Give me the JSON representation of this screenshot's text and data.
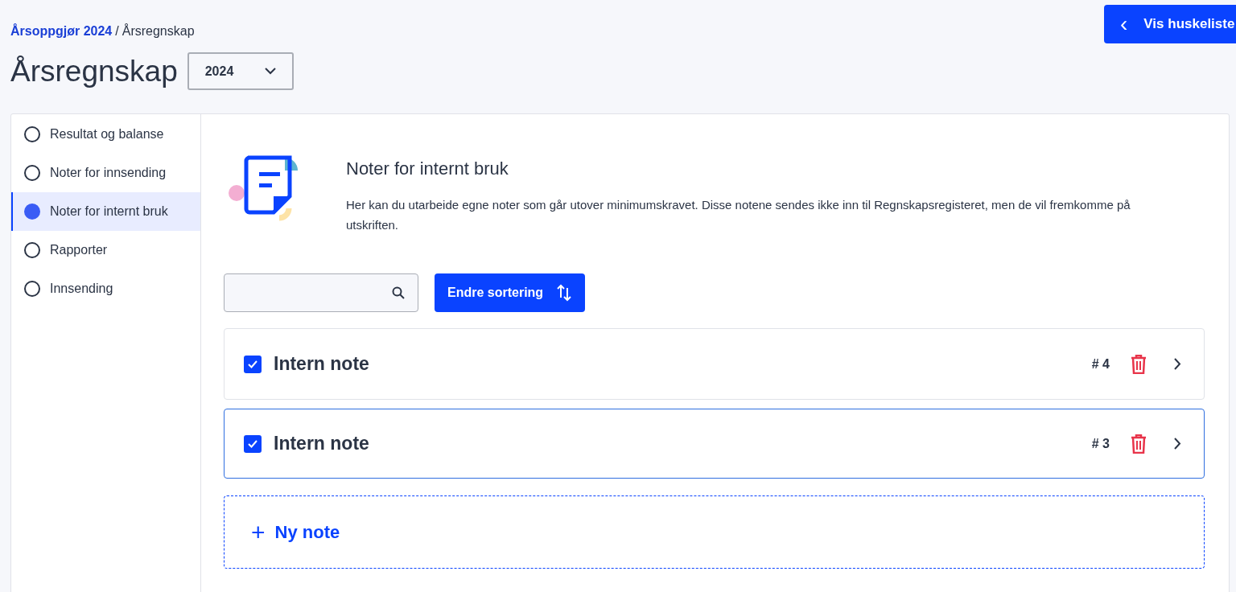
{
  "breadcrumb": {
    "link": "Årsoppgjør 2024",
    "separator": "/",
    "current": "Årsregnskap"
  },
  "reminder_button": {
    "label": "Vis huskeliste",
    "icon": "‹"
  },
  "title": "Årsregnskap",
  "year_select": {
    "value": "2024"
  },
  "sidebar": {
    "items": [
      {
        "label": "Resultat og balanse",
        "selected": false
      },
      {
        "label": "Noter for innsending",
        "selected": false
      },
      {
        "label": "Noter for internt bruk",
        "selected": true
      },
      {
        "label": "Rapporter",
        "selected": false
      },
      {
        "label": "Innsending",
        "selected": false
      }
    ]
  },
  "intro": {
    "heading": "Noter for internt bruk",
    "text": "Her kan du utarbeide egne noter som går utover minimumskravet. Disse notene sendes ikke inn til Regnskapsregisteret, men de vil fremkomme på utskriften."
  },
  "sort_button": {
    "label": "Endre sortering"
  },
  "notes": [
    {
      "title": "Intern note",
      "number": "# 4",
      "checked": true,
      "selected": false
    },
    {
      "title": "Intern note",
      "number": "# 3",
      "checked": true,
      "selected": true
    }
  ],
  "new_note": {
    "label": "Ny note",
    "icon": "+"
  }
}
